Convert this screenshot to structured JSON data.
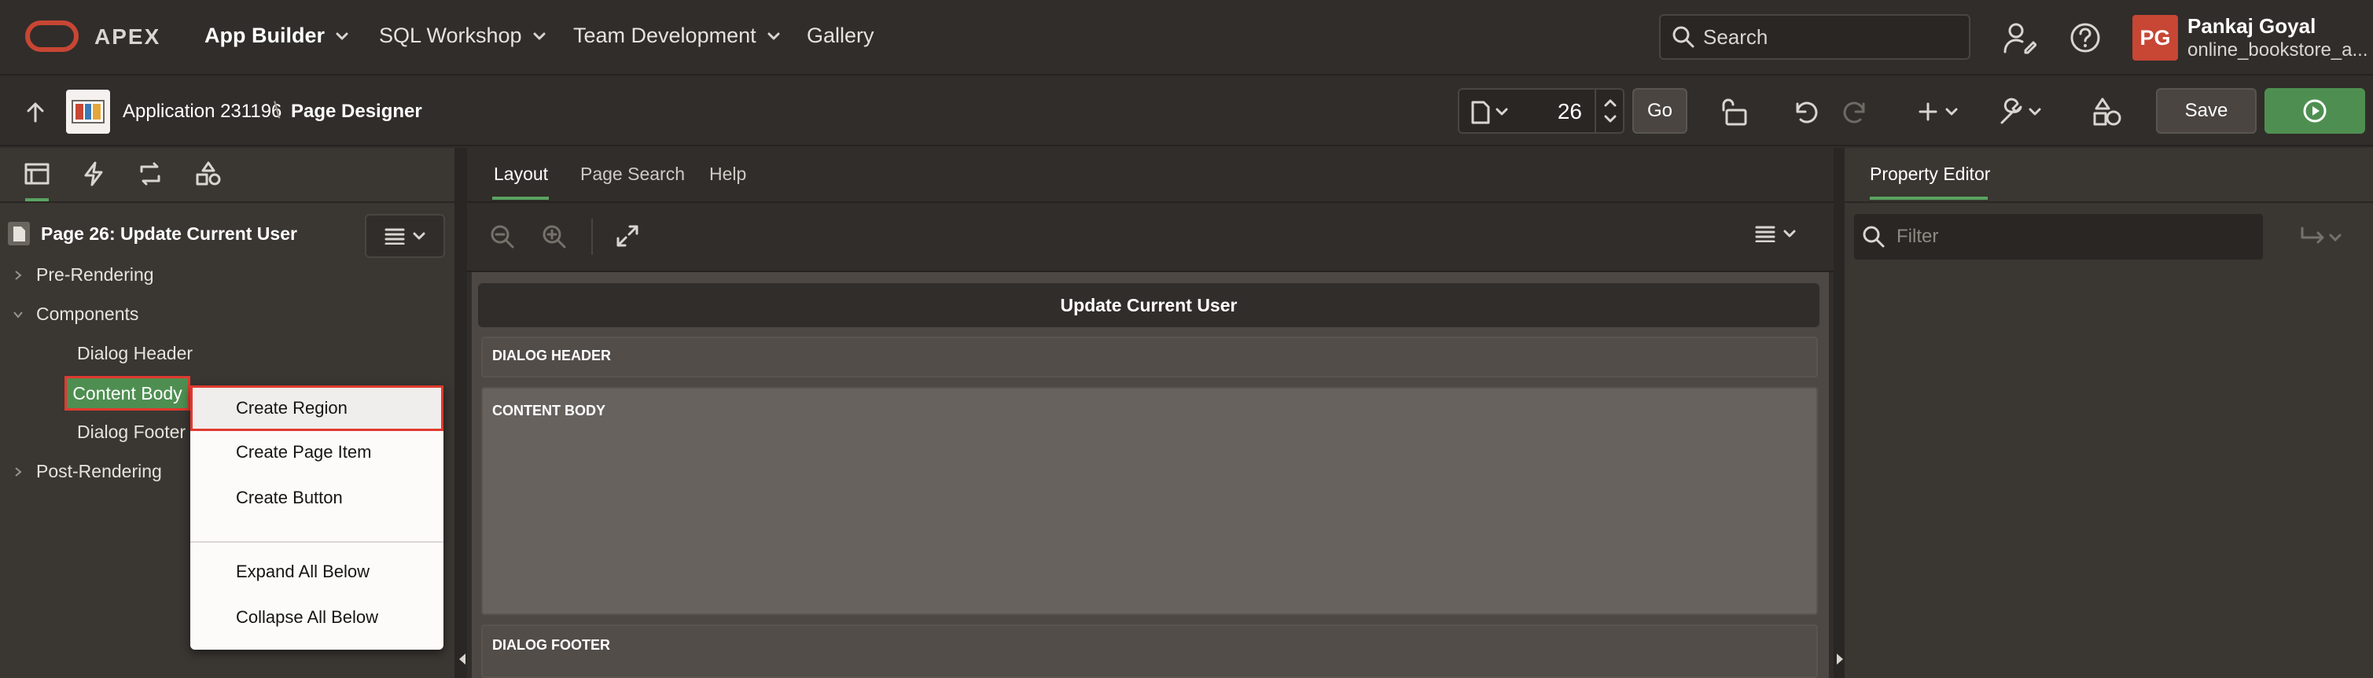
{
  "brand": "APEX",
  "nav": [
    {
      "label": "App Builder",
      "active": true,
      "dropdown": true
    },
    {
      "label": "SQL Workshop",
      "active": false,
      "dropdown": true
    },
    {
      "label": "Team Development",
      "active": false,
      "dropdown": true
    },
    {
      "label": "Gallery",
      "active": false,
      "dropdown": false
    }
  ],
  "search": {
    "placeholder": "Search"
  },
  "user": {
    "initials": "PG",
    "name": "Pankaj Goyal",
    "workspace": "online_bookstore_a..."
  },
  "toolbar": {
    "app_label": "Application 231196",
    "separator": "\\",
    "page_label": "Page Designer",
    "page_number": "26",
    "go_label": "Go",
    "save_label": "Save"
  },
  "tree": {
    "root": "Page 26: Update Current User",
    "nodes": {
      "pre": "Pre-Rendering",
      "components": "Components",
      "dialog_header": "Dialog Header",
      "content_body": "Content Body",
      "dialog_footer": "Dialog Footer",
      "post": "Post-Rendering"
    }
  },
  "context_menu": {
    "create_region": "Create Region",
    "create_page_item": "Create Page Item",
    "create_button": "Create Button",
    "expand_all": "Expand All Below",
    "collapse_all": "Collapse All Below"
  },
  "center": {
    "tabs": {
      "layout": "Layout",
      "page_search": "Page Search",
      "help": "Help"
    },
    "page_title": "Update Current User",
    "regions": {
      "header": "DIALOG HEADER",
      "body": "CONTENT BODY",
      "footer": "DIALOG FOOTER"
    }
  },
  "property_editor": {
    "title": "Property Editor",
    "filter_placeholder": "Filter"
  },
  "colors": {
    "accent": "#5aa361",
    "highlight": "#e03a2f",
    "run": "#4e8f51",
    "avatar": "#c74634"
  }
}
